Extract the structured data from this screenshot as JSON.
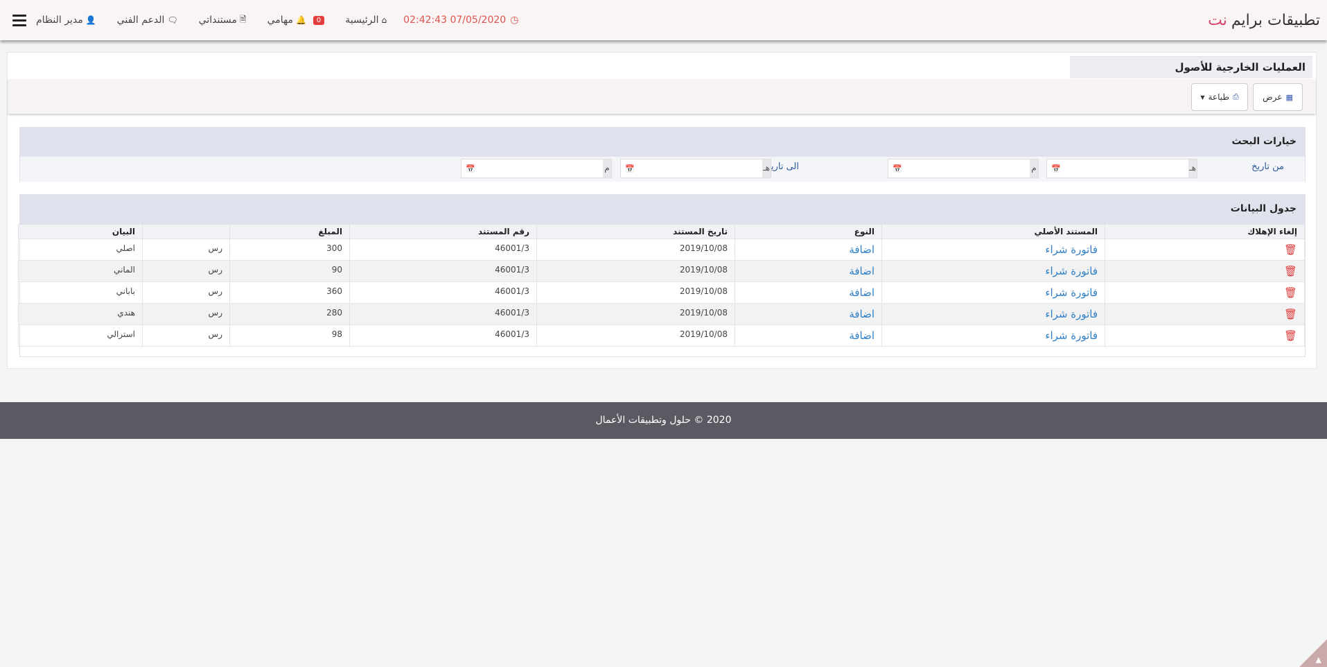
{
  "header": {
    "brand_main": "تطبيقات برايم",
    "brand_accent": "نت",
    "user": "مدير النظام",
    "support": "الدعم الفني",
    "documents": "مستنداتي",
    "tasks": "مهامي",
    "tasks_badge": "0",
    "home": "الرئيسية",
    "datetime": "02:42:43 07/05/2020"
  },
  "page": {
    "title": "العمليات الخارجية للأصول",
    "view_button": "عرض",
    "print_button": "طباعة"
  },
  "search": {
    "title": "خيارات البحث",
    "from_label": "من تاريخ",
    "to_label": "الى تاريخ",
    "hijri_unit": "هـ",
    "greg_unit": "م"
  },
  "table": {
    "title": "جدول البيانات",
    "headers": {
      "cancel": "إلغاء الإهلاك",
      "original_doc": "المستند الأصلي",
      "type": "النوع",
      "doc_date": "تاريخ المستند",
      "doc_no": "رقم المستند",
      "amount": "المبلغ",
      "currency": "",
      "statement": "البيان"
    },
    "rows": [
      {
        "original_doc": "فاتورة شراء",
        "type": "اضافة",
        "doc_date": "2019/10/08",
        "doc_no": "46001/3",
        "amount": "300",
        "currency": "رس",
        "statement": "اصلي"
      },
      {
        "original_doc": "فاتورة شراء",
        "type": "اضافة",
        "doc_date": "2019/10/08",
        "doc_no": "46001/3",
        "amount": "90",
        "currency": "رس",
        "statement": "الماني"
      },
      {
        "original_doc": "فاتورة شراء",
        "type": "اضافة",
        "doc_date": "2019/10/08",
        "doc_no": "46001/3",
        "amount": "360",
        "currency": "رس",
        "statement": "باباني"
      },
      {
        "original_doc": "فاتورة شراء",
        "type": "اضافة",
        "doc_date": "2019/10/08",
        "doc_no": "46001/3",
        "amount": "280",
        "currency": "رس",
        "statement": "هندي"
      },
      {
        "original_doc": "فاتورة شراء",
        "type": "اضافة",
        "doc_date": "2019/10/08",
        "doc_no": "46001/3",
        "amount": "98",
        "currency": "رس",
        "statement": "استرالي"
      }
    ]
  },
  "footer": {
    "text": "2020 © حلول وتطبيقات الأعمال"
  },
  "icons": {
    "menu": "hamburger-icon",
    "user": "user-icon",
    "support": "comments-icon",
    "documents": "file-icon",
    "tasks": "bell-icon",
    "home": "home-icon",
    "clock": "clock-icon",
    "table": "table-icon",
    "print": "print-icon",
    "calendar": "calendar-icon",
    "delete": "trash-icon"
  },
  "colors": {
    "accent": "#d9436b",
    "link": "#2f7fc6",
    "danger": "#e03a3a",
    "footer": "#5a5b62"
  }
}
